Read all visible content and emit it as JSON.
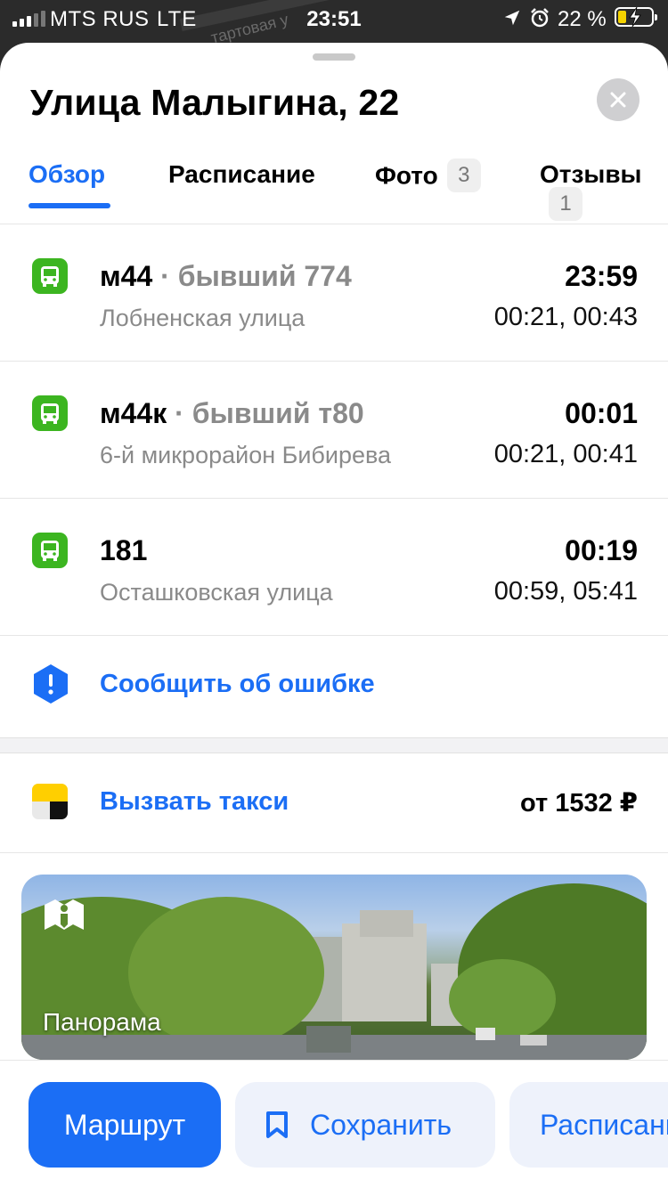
{
  "status_bar": {
    "carrier": "MTS RUS",
    "network": "LTE",
    "time": "23:51",
    "battery_percent": "22 %",
    "icons": [
      "signal-icon",
      "location-arrow-icon",
      "alarm-icon",
      "battery-charging-icon"
    ]
  },
  "map": {
    "street_label": "тартовая у"
  },
  "sheet": {
    "title": "Улица Малыгина, 22",
    "tabs": [
      {
        "label": "Обзор",
        "active": true
      },
      {
        "label": "Расписание"
      },
      {
        "label": "Фото",
        "badge": "3"
      },
      {
        "label": "Отзывы",
        "badge": "1"
      }
    ],
    "routes": [
      {
        "number": "м44",
        "former": "· бывший 774",
        "destination": "Лобненская улица",
        "next": "23:59",
        "later": "00:21, 00:43"
      },
      {
        "number": "м44к",
        "former": "· бывший т80",
        "destination": "6-й микрорайон Бибирева",
        "next": "00:01",
        "later": "00:21, 00:41"
      },
      {
        "number": "181",
        "former": "",
        "destination": "Осташковская улица",
        "next": "00:19",
        "later": "00:59, 05:41"
      }
    ],
    "report_error": "Сообщить об ошибке",
    "taxi": {
      "label": "Вызвать такси",
      "price": "от 1532 ₽"
    },
    "panorama": {
      "label": "Панорама"
    }
  },
  "bottom_bar": {
    "route_button": "Маршрут",
    "save_button": "Сохранить",
    "schedule_button": "Расписание"
  },
  "colors": {
    "accent": "#1b6ef5",
    "bus_green": "#3cb520",
    "taxi_yellow": "#ffcf00",
    "secondary_text": "#8a8a8a"
  }
}
